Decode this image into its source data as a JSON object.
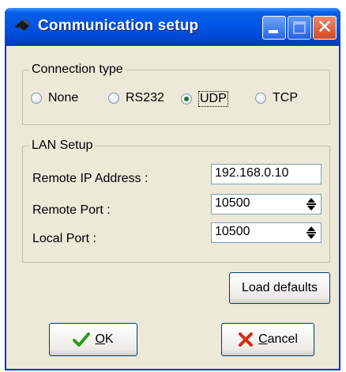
{
  "window": {
    "title": "Communication setup",
    "icons": {
      "app": "serial-cable-icon",
      "minimize": "minimize-icon",
      "maximize": "maximize-icon",
      "close": "close-icon"
    }
  },
  "connection_type": {
    "legend": "Connection type",
    "options": [
      {
        "label": "None",
        "checked": false
      },
      {
        "label": "RS232",
        "checked": false
      },
      {
        "label": "UDP",
        "checked": true
      },
      {
        "label": "TCP",
        "checked": false
      }
    ]
  },
  "lan_setup": {
    "legend": "LAN Setup",
    "remote_ip_label": "Remote IP Address :",
    "remote_ip_value": "192.168.0.10",
    "remote_port_label": "Remote Port :",
    "remote_port_value": "10500",
    "local_port_label": "Local Port :",
    "local_port_value": "10500"
  },
  "buttons": {
    "load_defaults": "Load defaults",
    "ok_mnemonic": "O",
    "ok_rest": "K",
    "cancel_mnemonic": "C",
    "cancel_rest": "ancel"
  },
  "colors": {
    "ok_check": "#2e9a1f",
    "cancel_x": "#d42a12",
    "titlebar": "#0055e5",
    "dialog_bg": "#ece9d8"
  }
}
